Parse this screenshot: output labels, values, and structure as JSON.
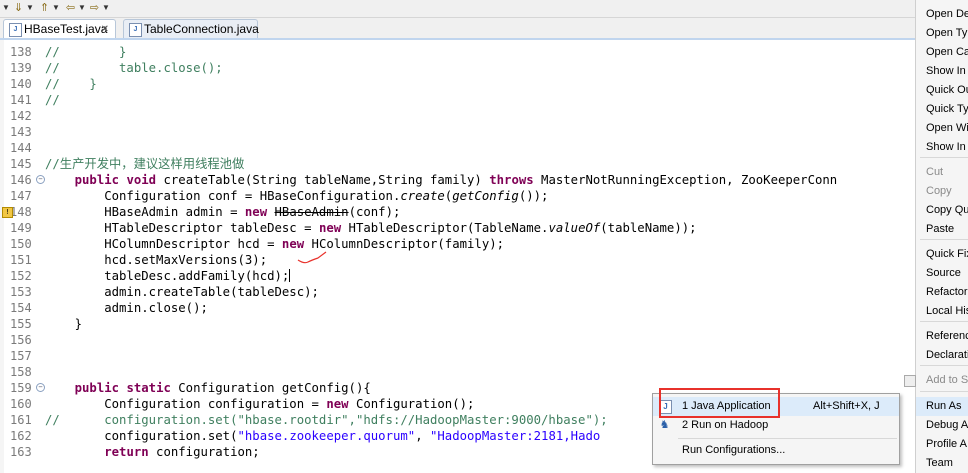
{
  "tabs": [
    {
      "label": "HBaseTest.java",
      "active": true
    },
    {
      "label": "TableConnection.java",
      "active": false
    }
  ],
  "editor": {
    "lines": [
      {
        "n": "138",
        "segs": [
          {
            "t": "//        }",
            "c": "cm"
          }
        ]
      },
      {
        "n": "139",
        "segs": [
          {
            "t": "//        table.close();",
            "c": "cm"
          }
        ]
      },
      {
        "n": "140",
        "segs": [
          {
            "t": "//    }",
            "c": "cm"
          }
        ]
      },
      {
        "n": "141",
        "segs": [
          {
            "t": "//",
            "c": "cm"
          }
        ]
      },
      {
        "n": "142",
        "segs": []
      },
      {
        "n": "143",
        "segs": []
      },
      {
        "n": "144",
        "segs": []
      },
      {
        "n": "145",
        "segs": [
          {
            "t": "//生产开发中，建议这样用线程池做",
            "c": "cm"
          }
        ]
      },
      {
        "n": "146",
        "fold": true,
        "segs": [
          {
            "t": "    "
          },
          {
            "t": "public",
            "c": "kw"
          },
          {
            "t": " "
          },
          {
            "t": "void",
            "c": "kw"
          },
          {
            "t": " createTable(String tableName,String family) "
          },
          {
            "t": "throws",
            "c": "kw"
          },
          {
            "t": " MasterNotRunningException, ZooKeeperConn"
          }
        ]
      },
      {
        "n": "147",
        "segs": [
          {
            "t": "        Configuration conf = HBaseConfiguration."
          },
          {
            "t": "create",
            "c": "it"
          },
          {
            "t": "("
          },
          {
            "t": "getConfig",
            "c": "it"
          },
          {
            "t": "());"
          }
        ]
      },
      {
        "n": "148",
        "warn": true,
        "segs": [
          {
            "t": "        HBaseAdmin admin = "
          },
          {
            "t": "new",
            "c": "kw"
          },
          {
            "t": " "
          },
          {
            "t": "HBaseAdmin",
            "c": "strike"
          },
          {
            "t": "(conf);"
          }
        ]
      },
      {
        "n": "149",
        "segs": [
          {
            "t": "        HTableDescriptor tableDesc = "
          },
          {
            "t": "new",
            "c": "kw"
          },
          {
            "t": " HTableDescriptor(TableName."
          },
          {
            "t": "valueOf",
            "c": "it"
          },
          {
            "t": "(tableName));"
          }
        ]
      },
      {
        "n": "150",
        "segs": [
          {
            "t": "        HColumnDescriptor hcd = "
          },
          {
            "t": "new",
            "c": "kw"
          },
          {
            "t": " HColumnDescriptor(family);"
          }
        ]
      },
      {
        "n": "151",
        "segs": [
          {
            "t": "        hcd.setMaxVersions(3);"
          }
        ]
      },
      {
        "n": "152",
        "cursor": true,
        "segs": [
          {
            "t": "        tableDesc.addFamily(hcd);"
          }
        ]
      },
      {
        "n": "153",
        "segs": [
          {
            "t": "        admin.createTable(tableDesc);"
          }
        ]
      },
      {
        "n": "154",
        "segs": [
          {
            "t": "        admin.close();"
          }
        ]
      },
      {
        "n": "155",
        "segs": [
          {
            "t": "    }"
          }
        ]
      },
      {
        "n": "156",
        "segs": []
      },
      {
        "n": "157",
        "segs": []
      },
      {
        "n": "158",
        "segs": []
      },
      {
        "n": "159",
        "fold": true,
        "segs": [
          {
            "t": "    "
          },
          {
            "t": "public",
            "c": "kw"
          },
          {
            "t": " "
          },
          {
            "t": "static",
            "c": "kw"
          },
          {
            "t": " Configuration getConfig(){"
          }
        ]
      },
      {
        "n": "160",
        "segs": [
          {
            "t": "        Configuration configuration = "
          },
          {
            "t": "new",
            "c": "kw"
          },
          {
            "t": " Configuration();"
          }
        ]
      },
      {
        "n": "161",
        "segs": [
          {
            "t": "//      configuration.set(\"hbase.rootdir\",\"hdfs://HadoopMaster:9000/hbase\");",
            "c": "cm"
          }
        ]
      },
      {
        "n": "162",
        "segs": [
          {
            "t": "        configuration.set("
          },
          {
            "t": "\"hbase.zookeeper.quorum\"",
            "c": "str"
          },
          {
            "t": ", "
          },
          {
            "t": "\"HadoopMaster:2181,Hado",
            "c": "str"
          }
        ]
      },
      {
        "n": "163",
        "segs": [
          {
            "t": "        "
          },
          {
            "t": "return",
            "c": "kw"
          },
          {
            "t": " configuration;"
          }
        ]
      }
    ]
  },
  "context_menu": {
    "items": [
      {
        "label": "Open De",
        "disabled": false
      },
      {
        "label": "Open Typ",
        "disabled": false
      },
      {
        "label": "Open Ca",
        "disabled": false
      },
      {
        "label": "Show In",
        "disabled": false
      },
      {
        "label": "Quick Ou",
        "disabled": false
      },
      {
        "label": "Quick Ty",
        "disabled": false
      },
      {
        "label": "Open Wi",
        "disabled": false
      },
      {
        "label": "Show In",
        "disabled": false
      },
      {
        "label": "Cut",
        "disabled": true
      },
      {
        "label": "Copy",
        "disabled": true
      },
      {
        "label": "Copy Qu",
        "disabled": false
      },
      {
        "label": "Paste",
        "disabled": false
      },
      {
        "label": "Quick Fix",
        "disabled": false
      },
      {
        "label": "Source",
        "disabled": false
      },
      {
        "label": "Refactor",
        "disabled": false
      },
      {
        "label": "Local His",
        "disabled": false
      },
      {
        "label": "Referenc",
        "disabled": false
      },
      {
        "label": "Declaratio",
        "disabled": false
      },
      {
        "label": "Add to S",
        "disabled": true
      },
      {
        "label": "Run As",
        "disabled": false
      },
      {
        "label": "Debug A",
        "disabled": false
      },
      {
        "label": "Profile A",
        "disabled": false
      },
      {
        "label": "Team",
        "disabled": false
      }
    ]
  },
  "run_as_submenu": {
    "items": [
      {
        "label": "1 Java Application",
        "shortcut": "Alt+Shift+X, J"
      },
      {
        "label": "2 Run on Hadoop",
        "shortcut": ""
      },
      {
        "label": "Run Configurations...",
        "shortcut": ""
      }
    ]
  }
}
